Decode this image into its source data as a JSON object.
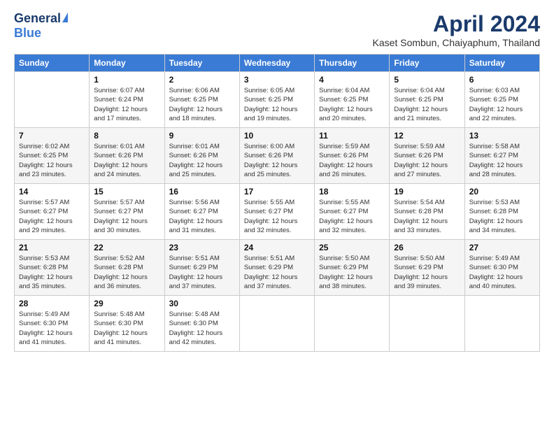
{
  "header": {
    "logo": {
      "general": "General",
      "blue": "Blue",
      "tagline": ""
    },
    "title": "April 2024",
    "subtitle": "Kaset Sombun, Chaiyaphum, Thailand"
  },
  "weekdays": [
    "Sunday",
    "Monday",
    "Tuesday",
    "Wednesday",
    "Thursday",
    "Friday",
    "Saturday"
  ],
  "weeks": [
    [
      {
        "day": null
      },
      {
        "day": 1,
        "sunrise": "Sunrise: 6:07 AM",
        "sunset": "Sunset: 6:24 PM",
        "daylight": "Daylight: 12 hours and 17 minutes."
      },
      {
        "day": 2,
        "sunrise": "Sunrise: 6:06 AM",
        "sunset": "Sunset: 6:25 PM",
        "daylight": "Daylight: 12 hours and 18 minutes."
      },
      {
        "day": 3,
        "sunrise": "Sunrise: 6:05 AM",
        "sunset": "Sunset: 6:25 PM",
        "daylight": "Daylight: 12 hours and 19 minutes."
      },
      {
        "day": 4,
        "sunrise": "Sunrise: 6:04 AM",
        "sunset": "Sunset: 6:25 PM",
        "daylight": "Daylight: 12 hours and 20 minutes."
      },
      {
        "day": 5,
        "sunrise": "Sunrise: 6:04 AM",
        "sunset": "Sunset: 6:25 PM",
        "daylight": "Daylight: 12 hours and 21 minutes."
      },
      {
        "day": 6,
        "sunrise": "Sunrise: 6:03 AM",
        "sunset": "Sunset: 6:25 PM",
        "daylight": "Daylight: 12 hours and 22 minutes."
      }
    ],
    [
      {
        "day": 7,
        "sunrise": "Sunrise: 6:02 AM",
        "sunset": "Sunset: 6:25 PM",
        "daylight": "Daylight: 12 hours and 23 minutes."
      },
      {
        "day": 8,
        "sunrise": "Sunrise: 6:01 AM",
        "sunset": "Sunset: 6:26 PM",
        "daylight": "Daylight: 12 hours and 24 minutes."
      },
      {
        "day": 9,
        "sunrise": "Sunrise: 6:01 AM",
        "sunset": "Sunset: 6:26 PM",
        "daylight": "Daylight: 12 hours and 25 minutes."
      },
      {
        "day": 10,
        "sunrise": "Sunrise: 6:00 AM",
        "sunset": "Sunset: 6:26 PM",
        "daylight": "Daylight: 12 hours and 25 minutes."
      },
      {
        "day": 11,
        "sunrise": "Sunrise: 5:59 AM",
        "sunset": "Sunset: 6:26 PM",
        "daylight": "Daylight: 12 hours and 26 minutes."
      },
      {
        "day": 12,
        "sunrise": "Sunrise: 5:59 AM",
        "sunset": "Sunset: 6:26 PM",
        "daylight": "Daylight: 12 hours and 27 minutes."
      },
      {
        "day": 13,
        "sunrise": "Sunrise: 5:58 AM",
        "sunset": "Sunset: 6:27 PM",
        "daylight": "Daylight: 12 hours and 28 minutes."
      }
    ],
    [
      {
        "day": 14,
        "sunrise": "Sunrise: 5:57 AM",
        "sunset": "Sunset: 6:27 PM",
        "daylight": "Daylight: 12 hours and 29 minutes."
      },
      {
        "day": 15,
        "sunrise": "Sunrise: 5:57 AM",
        "sunset": "Sunset: 6:27 PM",
        "daylight": "Daylight: 12 hours and 30 minutes."
      },
      {
        "day": 16,
        "sunrise": "Sunrise: 5:56 AM",
        "sunset": "Sunset: 6:27 PM",
        "daylight": "Daylight: 12 hours and 31 minutes."
      },
      {
        "day": 17,
        "sunrise": "Sunrise: 5:55 AM",
        "sunset": "Sunset: 6:27 PM",
        "daylight": "Daylight: 12 hours and 32 minutes."
      },
      {
        "day": 18,
        "sunrise": "Sunrise: 5:55 AM",
        "sunset": "Sunset: 6:27 PM",
        "daylight": "Daylight: 12 hours and 32 minutes."
      },
      {
        "day": 19,
        "sunrise": "Sunrise: 5:54 AM",
        "sunset": "Sunset: 6:28 PM",
        "daylight": "Daylight: 12 hours and 33 minutes."
      },
      {
        "day": 20,
        "sunrise": "Sunrise: 5:53 AM",
        "sunset": "Sunset: 6:28 PM",
        "daylight": "Daylight: 12 hours and 34 minutes."
      }
    ],
    [
      {
        "day": 21,
        "sunrise": "Sunrise: 5:53 AM",
        "sunset": "Sunset: 6:28 PM",
        "daylight": "Daylight: 12 hours and 35 minutes."
      },
      {
        "day": 22,
        "sunrise": "Sunrise: 5:52 AM",
        "sunset": "Sunset: 6:28 PM",
        "daylight": "Daylight: 12 hours and 36 minutes."
      },
      {
        "day": 23,
        "sunrise": "Sunrise: 5:51 AM",
        "sunset": "Sunset: 6:29 PM",
        "daylight": "Daylight: 12 hours and 37 minutes."
      },
      {
        "day": 24,
        "sunrise": "Sunrise: 5:51 AM",
        "sunset": "Sunset: 6:29 PM",
        "daylight": "Daylight: 12 hours and 37 minutes."
      },
      {
        "day": 25,
        "sunrise": "Sunrise: 5:50 AM",
        "sunset": "Sunset: 6:29 PM",
        "daylight": "Daylight: 12 hours and 38 minutes."
      },
      {
        "day": 26,
        "sunrise": "Sunrise: 5:50 AM",
        "sunset": "Sunset: 6:29 PM",
        "daylight": "Daylight: 12 hours and 39 minutes."
      },
      {
        "day": 27,
        "sunrise": "Sunrise: 5:49 AM",
        "sunset": "Sunset: 6:30 PM",
        "daylight": "Daylight: 12 hours and 40 minutes."
      }
    ],
    [
      {
        "day": 28,
        "sunrise": "Sunrise: 5:49 AM",
        "sunset": "Sunset: 6:30 PM",
        "daylight": "Daylight: 12 hours and 41 minutes."
      },
      {
        "day": 29,
        "sunrise": "Sunrise: 5:48 AM",
        "sunset": "Sunset: 6:30 PM",
        "daylight": "Daylight: 12 hours and 41 minutes."
      },
      {
        "day": 30,
        "sunrise": "Sunrise: 5:48 AM",
        "sunset": "Sunset: 6:30 PM",
        "daylight": "Daylight: 12 hours and 42 minutes."
      },
      {
        "day": null
      },
      {
        "day": null
      },
      {
        "day": null
      },
      {
        "day": null
      }
    ]
  ]
}
